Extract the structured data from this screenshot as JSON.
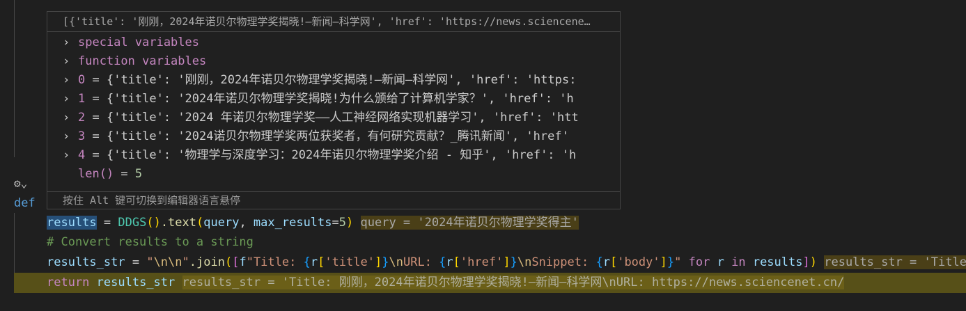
{
  "hover": {
    "header": "[{'title': '刚刚，2024年诺贝尔物理学奖揭晓!—新闻—科学网', 'href': 'https://news.sciencene…",
    "rows": [
      {
        "key": "special variables",
        "expandable": true
      },
      {
        "key": "function variables",
        "expandable": true
      },
      {
        "key": "0",
        "value": "{'title': '刚刚，2024年诺贝尔物理学奖揭晓!—新闻—科学网', 'href': 'https:",
        "expandable": true
      },
      {
        "key": "1",
        "value": "{'title': '2024年诺贝尔物理学奖揭晓!为什么颁给了计算机学家？', 'href': 'h",
        "expandable": true
      },
      {
        "key": "2",
        "value": "{'title': '2024 年诺贝尔物理学奖——人工神经网络实现机器学习', 'href': 'htt",
        "expandable": true
      },
      {
        "key": "3",
        "value": "{'title': '2024诺贝尔物理学奖两位获奖者，有何研究贡献？_腾讯新闻', 'href'",
        "expandable": true
      },
      {
        "key": "4",
        "value": "{'title': '物理学与深度学习：2024年诺贝尔物理学奖介绍 - 知乎', 'href': 'h",
        "expandable": true
      }
    ],
    "len_label": "len()",
    "len_value": "5",
    "footer": "按住 Alt 键可切换到编辑器语言悬停"
  },
  "editor": {
    "def_keyword": "def",
    "lines": [
      [
        [
          "t-var sel",
          "results"
        ],
        [
          "t-op",
          " = "
        ],
        [
          "t-cls",
          "DDGS"
        ],
        [
          "t-p1",
          "()"
        ],
        [
          "t-fn",
          ".text"
        ],
        [
          "t-p1",
          "("
        ],
        [
          "t-var",
          "query"
        ],
        [
          "t-op",
          ", "
        ],
        [
          "t-var",
          "max_results"
        ],
        [
          "t-op",
          "="
        ],
        [
          "t-num",
          "5"
        ],
        [
          "t-p1",
          ")"
        ],
        [
          "t-op",
          " "
        ],
        [
          "t-hint",
          "query = '2024年诺贝尔物理学奖得主'"
        ]
      ],
      [
        [
          "t-cmt",
          "# Convert results to a string"
        ]
      ],
      [
        [
          "t-var",
          "results_str"
        ],
        [
          "t-op",
          " = "
        ],
        [
          "t-str",
          "\""
        ],
        [
          "t-esc",
          "\\n\\n"
        ],
        [
          "t-str",
          "\""
        ],
        [
          "t-fn",
          ".join"
        ],
        [
          "t-p1",
          "("
        ],
        [
          "t-p2",
          "["
        ],
        [
          "t-var",
          "f"
        ],
        [
          "t-str",
          "\"Title: "
        ],
        [
          "t-p3",
          "{"
        ],
        [
          "t-var",
          "r"
        ],
        [
          "t-p1",
          "["
        ],
        [
          "t-str",
          "'title'"
        ],
        [
          "t-p1",
          "]"
        ],
        [
          "t-p3",
          "}"
        ],
        [
          "t-esc",
          "\\n"
        ],
        [
          "t-str",
          "URL: "
        ],
        [
          "t-p3",
          "{"
        ],
        [
          "t-var",
          "r"
        ],
        [
          "t-p1",
          "["
        ],
        [
          "t-str",
          "'href'"
        ],
        [
          "t-p1",
          "]"
        ],
        [
          "t-p3",
          "}"
        ],
        [
          "t-esc",
          "\\n"
        ],
        [
          "t-str",
          "Snippet: "
        ],
        [
          "t-p3",
          "{"
        ],
        [
          "t-var",
          "r"
        ],
        [
          "t-p1",
          "["
        ],
        [
          "t-str",
          "'body'"
        ],
        [
          "t-p1",
          "]"
        ],
        [
          "t-p3",
          "}"
        ],
        [
          "t-str",
          "\""
        ],
        [
          "t-op",
          " "
        ],
        [
          "t-kw",
          "for"
        ],
        [
          "t-op",
          " "
        ],
        [
          "t-var",
          "r"
        ],
        [
          "t-op",
          " "
        ],
        [
          "t-kw",
          "in"
        ],
        [
          "t-op",
          " "
        ],
        [
          "t-var",
          "results"
        ],
        [
          "t-p2",
          "]"
        ],
        [
          "t-p1",
          ")"
        ],
        [
          "t-op",
          " "
        ],
        [
          "t-hint",
          "results_str = 'Title: ..."
        ]
      ],
      [
        [
          "t-kw",
          "return"
        ],
        [
          "t-op",
          " "
        ],
        [
          "t-var",
          "results_str"
        ],
        [
          "t-op",
          " "
        ],
        [
          "t-hint2",
          "results_str = 'Title: 刚刚，2024年诺贝尔物理学奖揭晓!—新闻—科学网\\nURL: https://news.sciencenet.cn/"
        ]
      ]
    ]
  }
}
